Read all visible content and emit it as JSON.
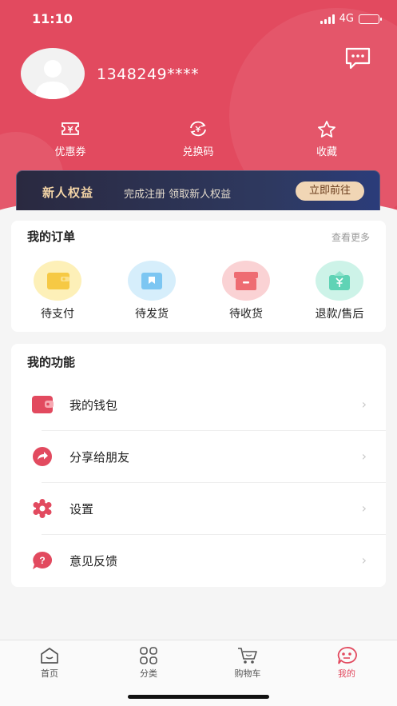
{
  "status_bar": {
    "time": "11:10",
    "network": "4G"
  },
  "profile": {
    "username": "1348249****"
  },
  "quick_actions": [
    {
      "label": "优惠券",
      "icon": "coupon-icon"
    },
    {
      "label": "兑换码",
      "icon": "exchange-code-icon"
    },
    {
      "label": "收藏",
      "icon": "star-icon"
    }
  ],
  "promo": {
    "title": "新人权益",
    "text": "完成注册 领取新人权益",
    "button": "立即前往"
  },
  "orders": {
    "title": "我的订单",
    "more": "查看更多",
    "items": [
      {
        "label": "待支付",
        "icon": "wallet-icon",
        "color": "#f6c944"
      },
      {
        "label": "待发货",
        "icon": "package-icon",
        "color": "#7cc6f2"
      },
      {
        "label": "待收货",
        "icon": "box-icon",
        "color": "#ee6c72"
      },
      {
        "label": "退款/售后",
        "icon": "refund-icon",
        "color": "#5fd3b5"
      }
    ]
  },
  "functions": {
    "title": "我的功能",
    "items": [
      {
        "label": "我的钱包",
        "icon": "wallet-icon"
      },
      {
        "label": "分享给朋友",
        "icon": "share-icon"
      },
      {
        "label": "设置",
        "icon": "gear-icon"
      },
      {
        "label": "意见反馈",
        "icon": "feedback-icon"
      }
    ]
  },
  "tabbar": [
    {
      "label": "首页",
      "icon": "home-icon"
    },
    {
      "label": "分类",
      "icon": "grid-icon"
    },
    {
      "label": "购物车",
      "icon": "cart-icon"
    },
    {
      "label": "我的",
      "icon": "profile-icon",
      "active": true
    }
  ],
  "colors": {
    "accent": "#e24a5f",
    "promo_button": "#f1d6b5"
  }
}
